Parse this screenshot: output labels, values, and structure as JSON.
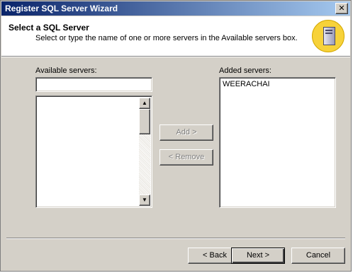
{
  "window": {
    "title": "Register SQL Server Wizard",
    "close_glyph": "✕"
  },
  "header": {
    "step_title": "Select a SQL Server",
    "step_description": "Select or type the name of one or more servers in the Available servers box.",
    "icon": "server-icon"
  },
  "available": {
    "label": "Available servers:",
    "input_value": "",
    "items": []
  },
  "added": {
    "label": "Added servers:",
    "items": [
      "WEERACHAI"
    ]
  },
  "buttons": {
    "add": "Add >",
    "remove": "< Remove",
    "back": "< Back",
    "next": "Next >",
    "cancel": "Cancel"
  },
  "scrollbar": {
    "up_glyph": "▲",
    "down_glyph": "▼"
  }
}
